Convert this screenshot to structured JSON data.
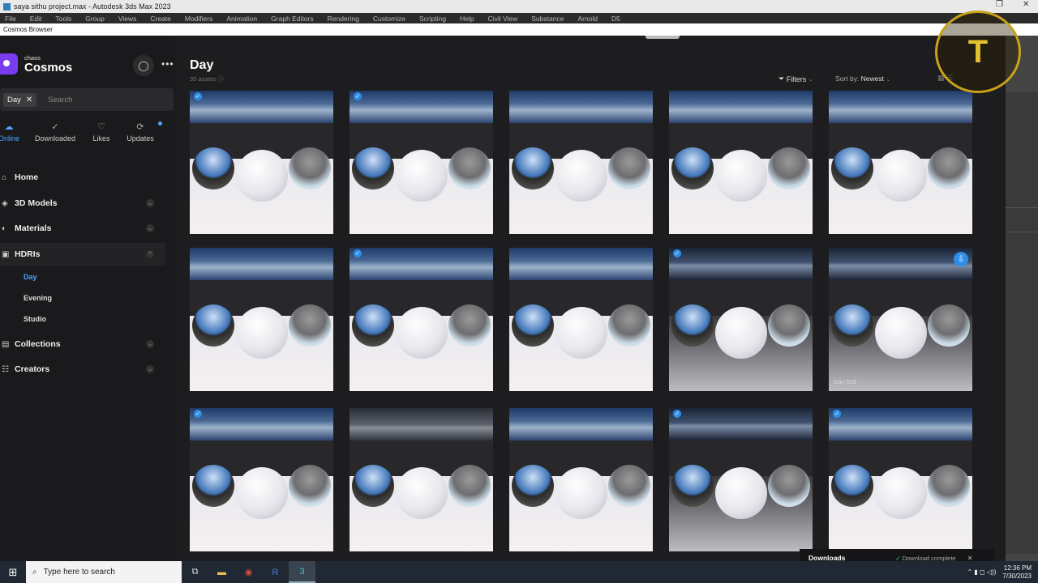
{
  "window": {
    "title": "saya sithu project.max - Autodesk 3ds Max 2023",
    "menus": [
      "File",
      "Edit",
      "Tools",
      "Group",
      "Views",
      "Create",
      "Modifiers",
      "Animation",
      "Graph Editors",
      "Rendering",
      "Customize",
      "Scripting",
      "Help",
      "Civil View",
      "Substance",
      "Arnold",
      "D5"
    ],
    "cosmos_title": "Cosmos Browser"
  },
  "brand": {
    "small": "chaos",
    "big": "Cosmos"
  },
  "search": {
    "chip": "Day",
    "placeholder": "Search"
  },
  "tabs": [
    {
      "label": "Online",
      "icon": "cloud-icon"
    },
    {
      "label": "Downloaded",
      "icon": "check-circle-icon"
    },
    {
      "label": "Likes",
      "icon": "heart-icon"
    },
    {
      "label": "Updates",
      "icon": "refresh-icon"
    }
  ],
  "nav": [
    {
      "label": "Home",
      "icon": "home-icon"
    },
    {
      "label": "3D Models",
      "icon": "cube-icon"
    },
    {
      "label": "Materials",
      "icon": "sphere-icon"
    },
    {
      "label": "HDRIs",
      "icon": "image-icon"
    },
    {
      "label": "Collections",
      "icon": "folder-icon"
    },
    {
      "label": "Creators",
      "icon": "people-icon"
    }
  ],
  "hdri_sub": [
    "Day",
    "Evening",
    "Studio"
  ],
  "page": {
    "title": "Day",
    "count": "35 assets"
  },
  "toolbar": {
    "filters": "Filters",
    "sort_prefix": "Sort by:",
    "sort_value": "Newest"
  },
  "cards": [
    {
      "checked": true,
      "sky": "cloudy",
      "label": ""
    },
    {
      "checked": true,
      "sky": "cloudy",
      "label": ""
    },
    {
      "checked": false,
      "sky": "cloudy",
      "label": ""
    },
    {
      "checked": false,
      "sky": "cloudy",
      "label": ""
    },
    {
      "checked": false,
      "sky": "cloudy",
      "label": ""
    },
    {
      "checked": false,
      "sky": "cloudy",
      "label": ""
    },
    {
      "checked": true,
      "sky": "cloudy",
      "label": ""
    },
    {
      "checked": false,
      "sky": "cloudy",
      "label": ""
    },
    {
      "checked": true,
      "sky": "dark",
      "label": ""
    },
    {
      "checked": false,
      "sky": "dark",
      "label": "Day 019",
      "download": true
    },
    {
      "checked": true,
      "sky": "cloudy",
      "label": ""
    },
    {
      "checked": false,
      "sky": "overcast",
      "label": ""
    },
    {
      "checked": false,
      "sky": "cloudy",
      "label": ""
    },
    {
      "checked": true,
      "sky": "dark",
      "label": ""
    },
    {
      "checked": true,
      "sky": "cloudy",
      "label": ""
    }
  ],
  "downloads": {
    "title": "Downloads",
    "status": "Download complete"
  },
  "taskbar": {
    "search_placeholder": "Type here to search",
    "time": "12:36 PM",
    "date": "7/30/2023"
  },
  "colors": {
    "accent": "#2e8fe8",
    "bg": "#1d1d1f",
    "sidebar": "#1a1a1c"
  }
}
